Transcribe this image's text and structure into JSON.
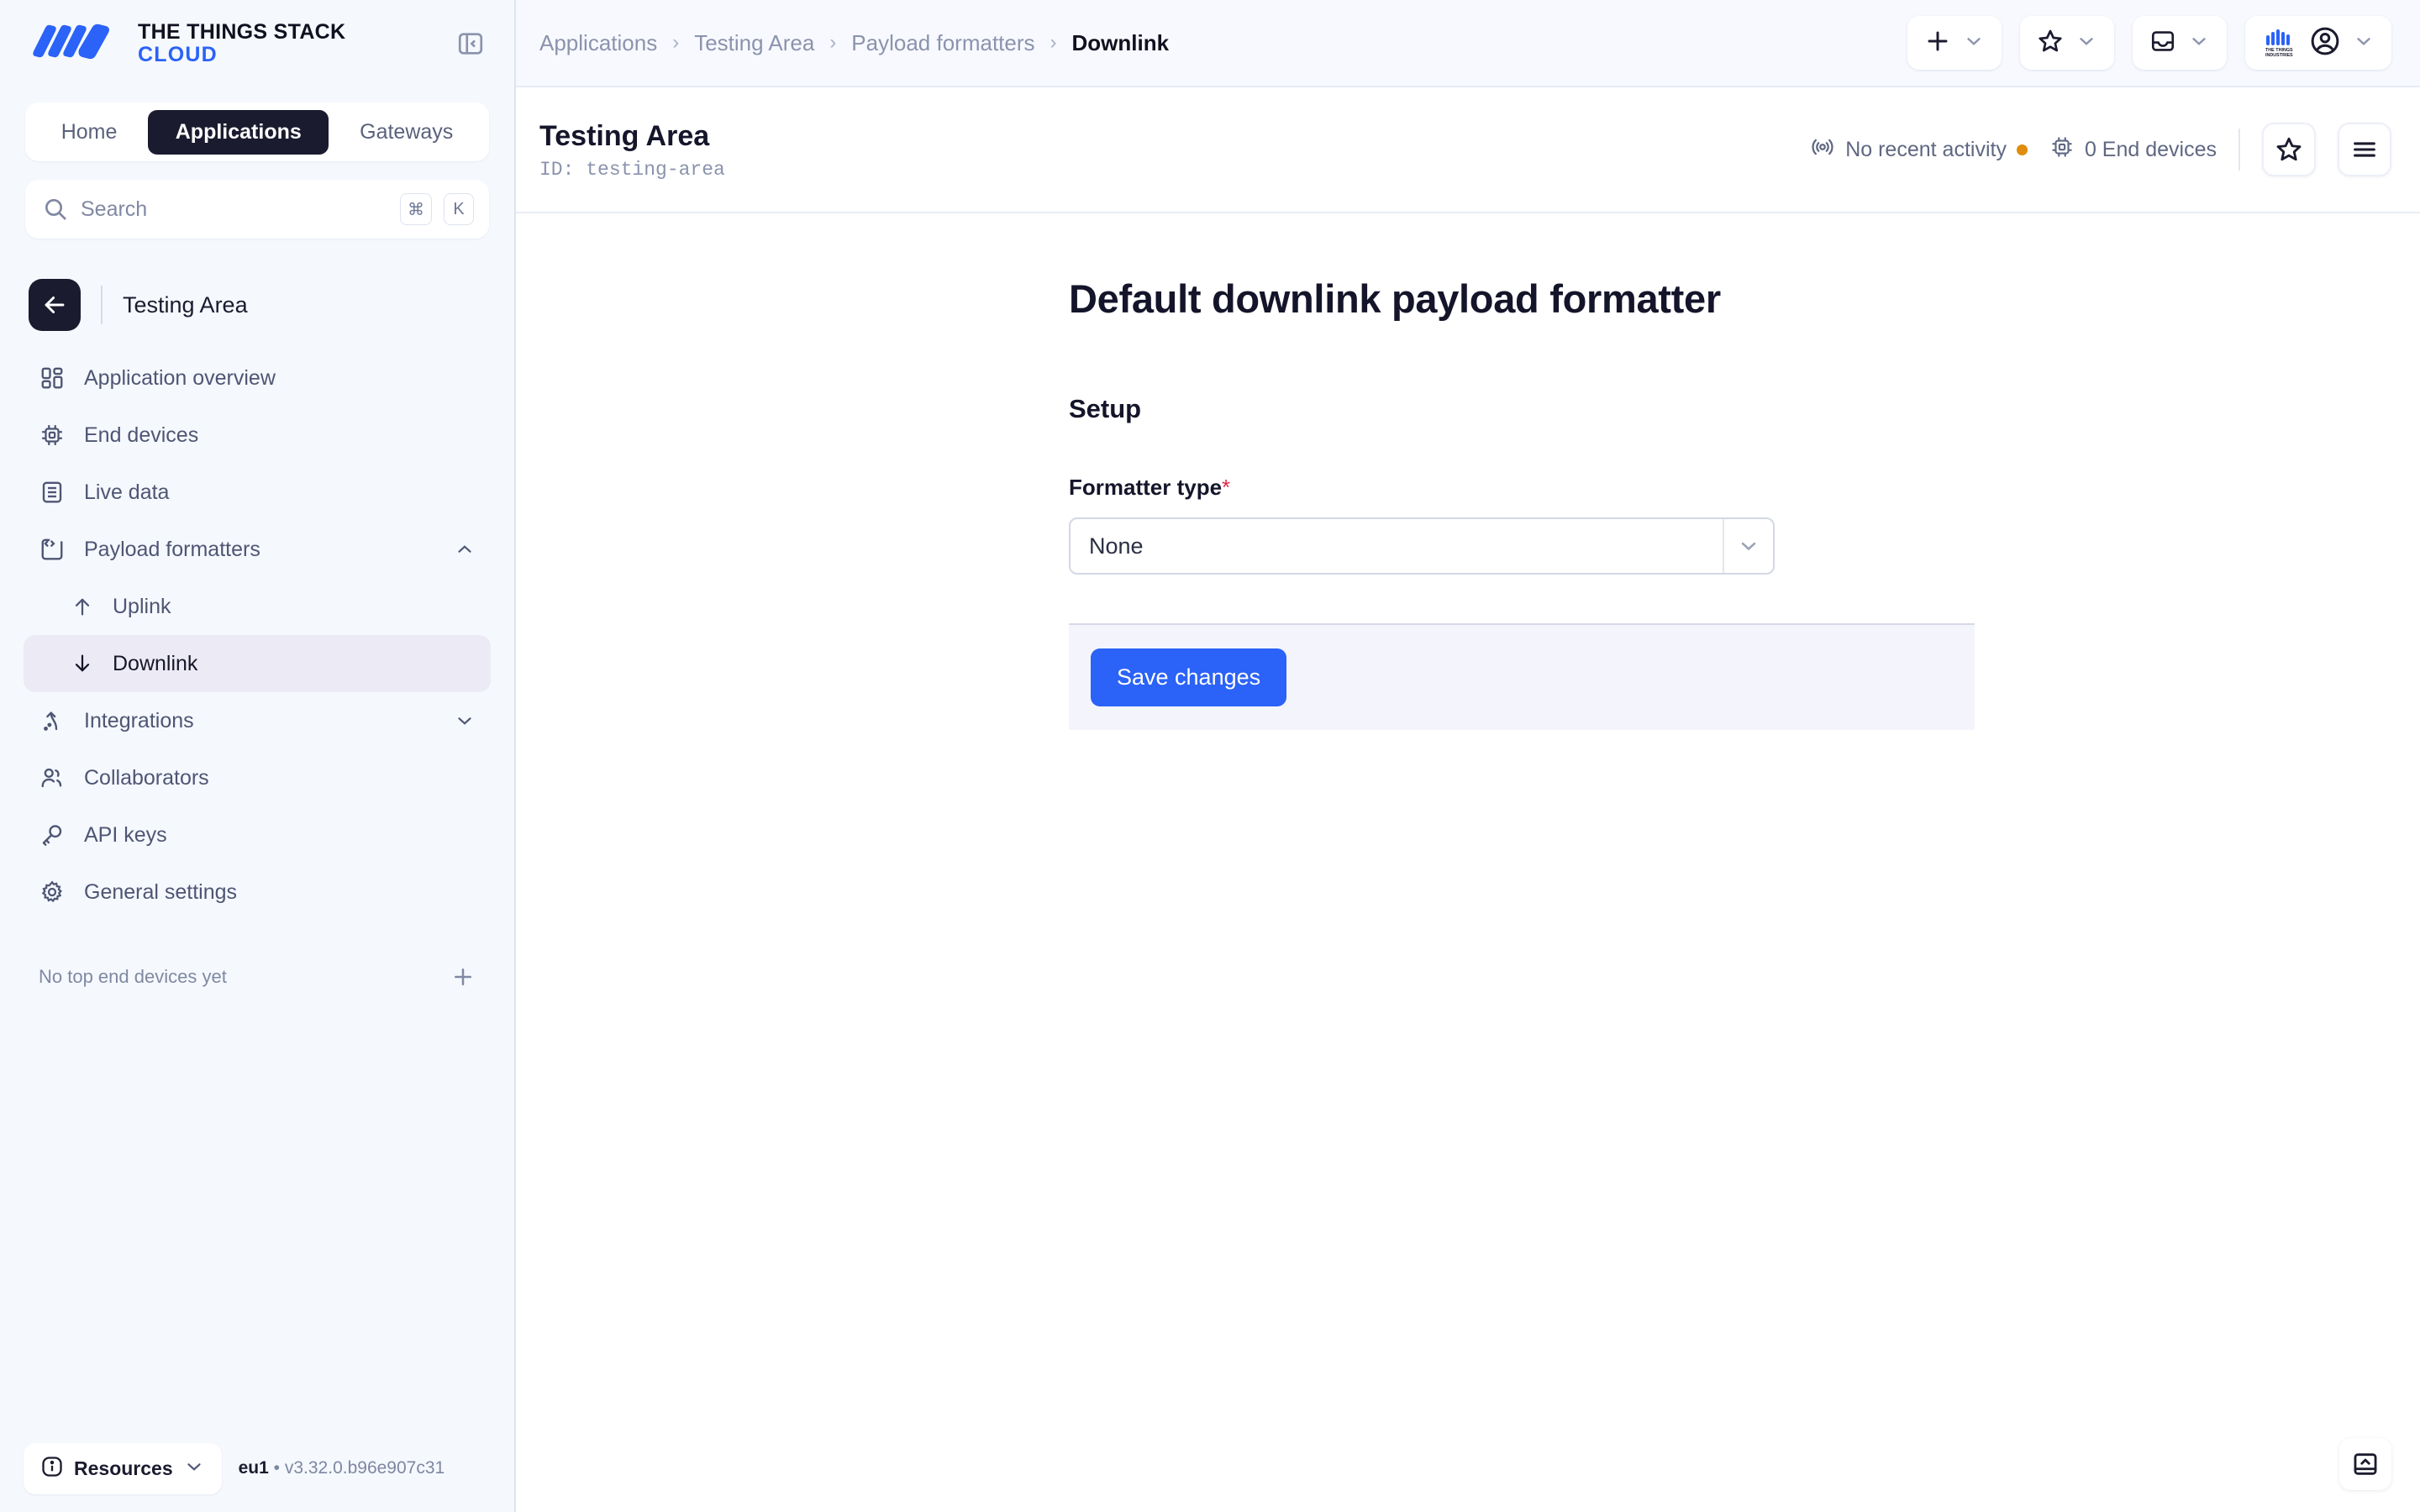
{
  "brand": {
    "line1": "THE THINGS STACK",
    "line2": "CLOUD",
    "accent_blue": "#2b62f7",
    "dark": "#1b1b2f"
  },
  "sidebar": {
    "collapse_icon": "panel-collapse-left-icon",
    "tabs": [
      {
        "label": "Home",
        "active": false
      },
      {
        "label": "Applications",
        "active": true
      },
      {
        "label": "Gateways",
        "active": false
      }
    ],
    "search": {
      "placeholder": "Search",
      "value": "",
      "icon": "search-icon",
      "shortcut_modifier": "⌘",
      "shortcut_key": "K"
    },
    "entity": {
      "back_icon": "arrow-left-icon",
      "name": "Testing Area"
    },
    "nav": [
      {
        "label": "Application overview",
        "icon": "dashboard-grid-icon",
        "active": false,
        "sub": false,
        "chevron": ""
      },
      {
        "label": "End devices",
        "icon": "chip-icon",
        "active": false,
        "sub": false,
        "chevron": ""
      },
      {
        "label": "Live data",
        "icon": "document-lines-icon",
        "active": false,
        "sub": false,
        "chevron": ""
      },
      {
        "label": "Payload formatters",
        "icon": "code-brackets-icon",
        "active": false,
        "sub": false,
        "chevron": "chevron-up-icon"
      },
      {
        "label": "Uplink",
        "icon": "arrow-up-icon",
        "active": false,
        "sub": true,
        "chevron": ""
      },
      {
        "label": "Downlink",
        "icon": "arrow-down-icon",
        "active": true,
        "sub": true,
        "chevron": ""
      },
      {
        "label": "Integrations",
        "icon": "integrations-icon",
        "active": false,
        "sub": false,
        "chevron": "chevron-down-icon"
      },
      {
        "label": "Collaborators",
        "icon": "users-icon",
        "active": false,
        "sub": false,
        "chevron": ""
      },
      {
        "label": "API keys",
        "icon": "key-icon",
        "active": false,
        "sub": false,
        "chevron": ""
      },
      {
        "label": "General settings",
        "icon": "gear-icon",
        "active": false,
        "sub": false,
        "chevron": ""
      }
    ],
    "top_devices": {
      "empty_label": "No top end devices yet",
      "add_icon": "plus-icon"
    },
    "footer": {
      "resources_label": "Resources",
      "resources_icon": "info-circle-icon",
      "resources_chevron": "chevron-down-icon",
      "region": "eu1",
      "separator": "•",
      "version": "v3.32.0.b96e907c31"
    }
  },
  "topbar": {
    "breadcrumb": [
      {
        "label": "Applications",
        "current": false
      },
      {
        "label": "Testing Area",
        "current": false
      },
      {
        "label": "Payload formatters",
        "current": false
      },
      {
        "label": "Downlink",
        "current": true
      }
    ],
    "breadcrumb_separator": "›",
    "actions": [
      {
        "name": "add-button",
        "icon": "plus-icon",
        "chevron": "chevron-down-icon"
      },
      {
        "name": "bookmarks-button",
        "icon": "star-icon",
        "chevron": "chevron-down-icon"
      },
      {
        "name": "notifications-button",
        "icon": "inbox-icon",
        "chevron": "chevron-down-icon"
      },
      {
        "name": "account-button",
        "icon": "things-industries-logo-icon",
        "secondary_icon": "user-avatar-icon",
        "chevron": "chevron-down-icon"
      }
    ]
  },
  "entity_bar": {
    "title": "Testing Area",
    "id_label": "ID: testing-area",
    "activity": {
      "icon": "broadcast-icon",
      "label": "No recent activity",
      "status_color": "#e08c0c"
    },
    "devices": {
      "icon": "chip-icon",
      "label": "0 End devices"
    },
    "star_button_icon": "star-icon",
    "menu_button_icon": "hamburger-menu-icon"
  },
  "main": {
    "page_title": "Default downlink payload formatter",
    "section_title": "Setup",
    "formatter_type": {
      "label": "Formatter type",
      "required_marker": "*",
      "selected": "None",
      "chevron": "chevron-down-icon"
    },
    "save_label": "Save changes",
    "save_color": "#2b62f7"
  },
  "overlay": {
    "bottom_right_panel_icon": "panel-expand-up-icon"
  }
}
